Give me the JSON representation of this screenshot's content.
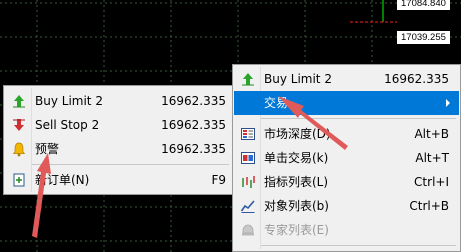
{
  "chart": {
    "price_label_1": "17084.840",
    "price_label_2": "17039.255",
    "colors": {
      "background": "#000000",
      "grid": "#3a5a3a",
      "candle": "#00ff00",
      "level": "#ff2020"
    }
  },
  "left_menu": {
    "items": [
      {
        "label": "Buy Limit 2",
        "value": "16962.335",
        "icon": "buy-limit-arrow-icon"
      },
      {
        "label": "Sell Stop 2",
        "value": "16962.335",
        "icon": "sell-stop-arrow-icon"
      },
      {
        "label": "预警",
        "value": "16962.335",
        "icon": "alarm-bell-icon"
      },
      {
        "label": "新订单(N)",
        "value": "F9",
        "icon": "new-order-icon"
      }
    ]
  },
  "right_menu": {
    "items": [
      {
        "label": "Buy Limit 2",
        "value": "16962.335",
        "icon": "buy-limit-arrow-icon"
      },
      {
        "label": "交易",
        "value": "",
        "icon": "",
        "highlighted": true,
        "submenu": true
      },
      {
        "label": "市场深度(D)",
        "value": "Alt+B",
        "icon": "market-depth-icon"
      },
      {
        "label": "单击交易(k)",
        "value": "Alt+T",
        "icon": "one-click-trading-icon"
      },
      {
        "label": "指标列表(L)",
        "value": "Ctrl+I",
        "icon": "indicators-list-icon"
      },
      {
        "label": "对象列表(b)",
        "value": "Ctrl+B",
        "icon": "objects-list-icon"
      },
      {
        "label": "专家列表(E)",
        "value": "",
        "icon": "experts-list-icon",
        "disabled": true
      }
    ]
  },
  "colors": {
    "menu_bg": "#f0f0f0",
    "highlight": "#0078d7",
    "annotation_arrow": "#e05a5a"
  }
}
